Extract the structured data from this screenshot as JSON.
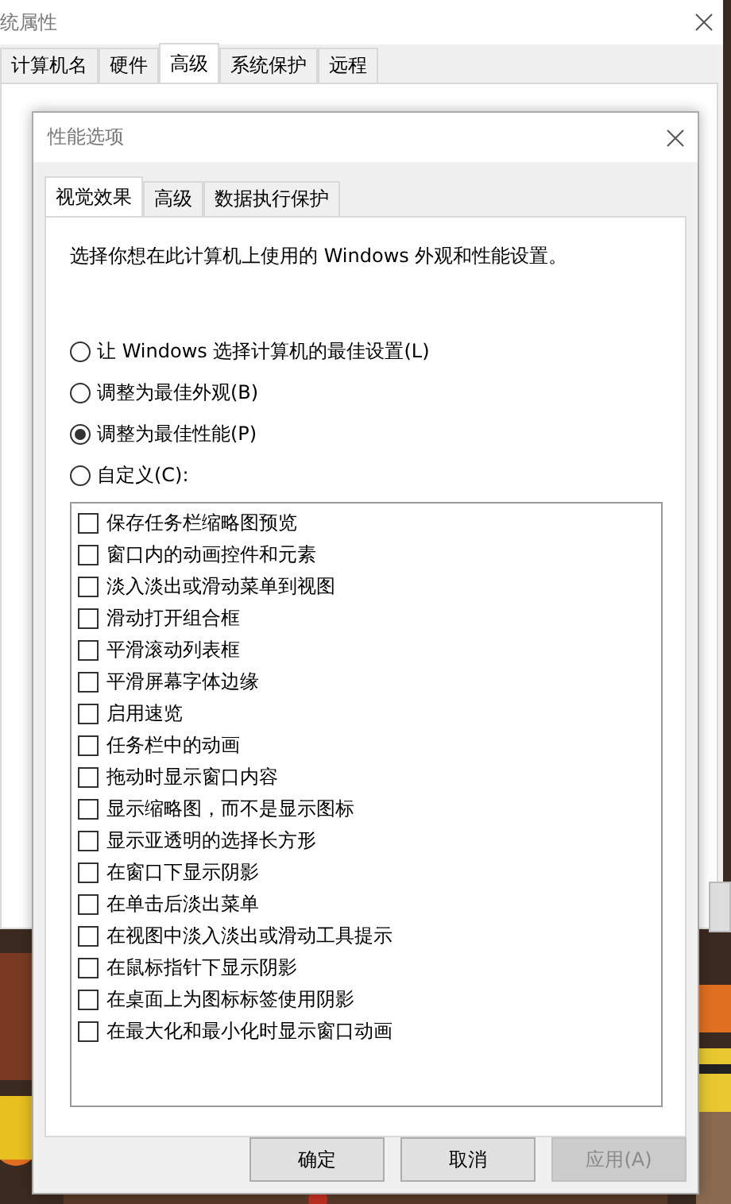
{
  "back_window": {
    "title": "统属性",
    "tabs": [
      {
        "label": "计算机名",
        "selected": false
      },
      {
        "label": "硬件",
        "selected": false
      },
      {
        "label": "高级",
        "selected": true
      },
      {
        "label": "系统保护",
        "selected": false
      },
      {
        "label": "远程",
        "selected": false
      }
    ]
  },
  "dialog": {
    "title": "性能选项",
    "tabs": [
      {
        "label": "视觉效果",
        "selected": true
      },
      {
        "label": "高级",
        "selected": false
      },
      {
        "label": "数据执行保护",
        "selected": false
      }
    ],
    "description": "选择你想在此计算机上使用的 Windows 外观和性能设置。",
    "options": [
      {
        "label": "让 Windows 选择计算机的最佳设置(L)",
        "selected": false
      },
      {
        "label": "调整为最佳外观(B)",
        "selected": false
      },
      {
        "label": "调整为最佳性能(P)",
        "selected": true
      },
      {
        "label": "自定义(C):",
        "selected": false
      }
    ],
    "effects": [
      {
        "label": "保存任务栏缩略图预览",
        "checked": false
      },
      {
        "label": "窗口内的动画控件和元素",
        "checked": false
      },
      {
        "label": "淡入淡出或滑动菜单到视图",
        "checked": false
      },
      {
        "label": "滑动打开组合框",
        "checked": false
      },
      {
        "label": "平滑滚动列表框",
        "checked": false
      },
      {
        "label": "平滑屏幕字体边缘",
        "checked": false
      },
      {
        "label": "启用速览",
        "checked": false
      },
      {
        "label": "任务栏中的动画",
        "checked": false
      },
      {
        "label": "拖动时显示窗口内容",
        "checked": false
      },
      {
        "label": "显示缩略图，而不是显示图标",
        "checked": false
      },
      {
        "label": "显示亚透明的选择长方形",
        "checked": false
      },
      {
        "label": "在窗口下显示阴影",
        "checked": false
      },
      {
        "label": "在单击后淡出菜单",
        "checked": false
      },
      {
        "label": "在视图中淡入淡出或滑动工具提示",
        "checked": false
      },
      {
        "label": "在鼠标指针下显示阴影",
        "checked": false
      },
      {
        "label": "在桌面上为图标标签使用阴影",
        "checked": false
      },
      {
        "label": "在最大化和最小化时显示窗口动画",
        "checked": false
      }
    ],
    "buttons": [
      {
        "label": "确定",
        "disabled": false
      },
      {
        "label": "取消",
        "disabled": false
      },
      {
        "label": "应用(A)",
        "disabled": true
      }
    ]
  }
}
